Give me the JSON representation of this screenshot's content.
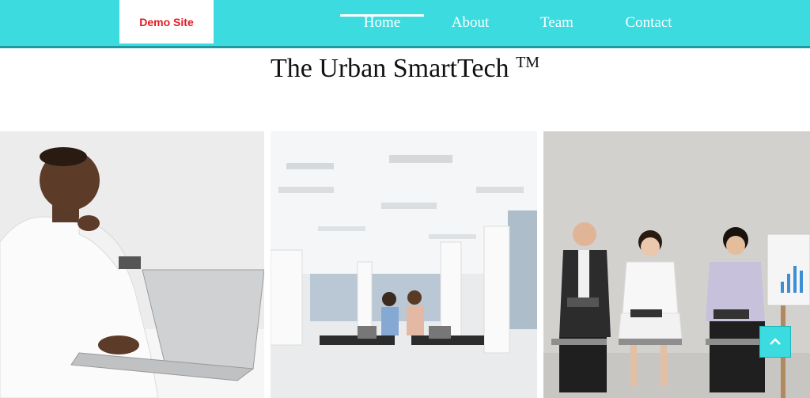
{
  "header": {
    "logo_text": "Demo Site",
    "nav": [
      {
        "label": "Home",
        "active": true
      },
      {
        "label": "About",
        "active": false
      },
      {
        "label": "Team",
        "active": false
      },
      {
        "label": "Contact",
        "active": false
      }
    ]
  },
  "main": {
    "title": "The Urban SmartTech",
    "trademark": "TM"
  },
  "gallery": [
    {
      "subject": "man-with-laptop-photo"
    },
    {
      "subject": "people-on-office-floor-photo"
    },
    {
      "subject": "people-seated-with-notebooks-photo"
    }
  ],
  "back_to_top": {
    "icon": "chevron-up-icon"
  },
  "colors": {
    "accent": "#3bdbe0",
    "logo_text": "#e01b22"
  }
}
